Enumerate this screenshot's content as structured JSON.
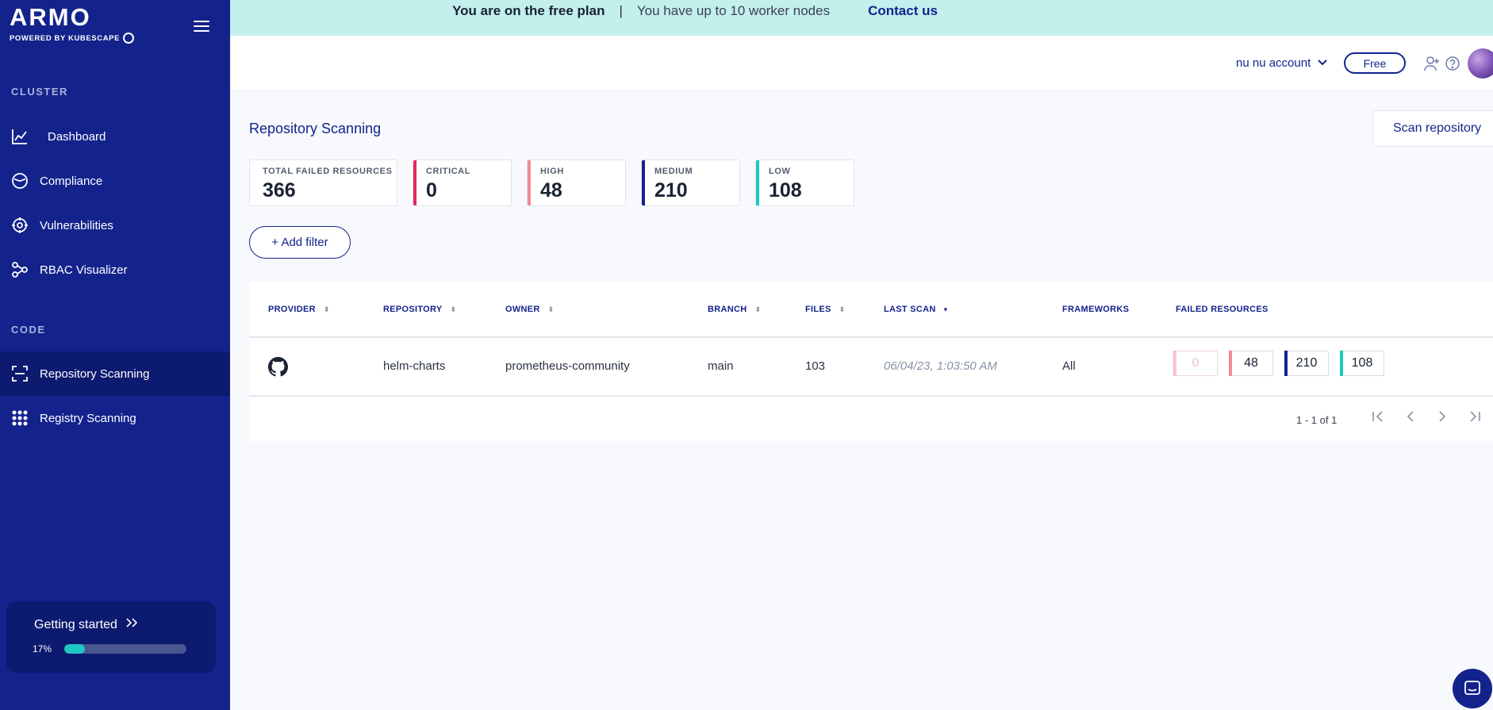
{
  "brand": {
    "name": "ARMO",
    "tagline": "POWERED BY KUBESCAPE"
  },
  "sidebar": {
    "sections": [
      {
        "label": "CLUSTER"
      },
      {
        "label": "CODE"
      }
    ],
    "cluster_items": [
      {
        "label": "Dashboard",
        "icon": "chart-icon"
      },
      {
        "label": "Compliance",
        "icon": "compliance-icon"
      },
      {
        "label": "Vulnerabilities",
        "icon": "vulnerability-icon"
      },
      {
        "label": "RBAC Visualizer",
        "icon": "graph-icon"
      }
    ],
    "code_items": [
      {
        "label": "Repository Scanning",
        "icon": "scan-icon",
        "active": true
      },
      {
        "label": "Registry Scanning",
        "icon": "grid-icon"
      }
    ],
    "getting_started": {
      "label": "Getting started",
      "percent_label": "17%",
      "progress": 0.17
    }
  },
  "banner": {
    "plan": "You are on the free plan",
    "separator": "|",
    "nodes": "You have up to 10 worker nodes",
    "contact": "Contact us"
  },
  "header": {
    "account": "nu nu account",
    "plan_pill": "Free"
  },
  "main": {
    "title": "Repository Scanning",
    "scan_button": "Scan repository",
    "add_filter": "+ Add filter",
    "stats": [
      {
        "label": "TOTAL FAILED RESOURCES",
        "value": "366"
      },
      {
        "label": "CRITICAL",
        "value": "0",
        "color": "#e8245c"
      },
      {
        "label": "HIGH",
        "value": "48",
        "color": "#f28a96"
      },
      {
        "label": "MEDIUM",
        "value": "210",
        "color": "#14238c"
      },
      {
        "label": "LOW",
        "value": "108",
        "color": "#1fc7c0"
      }
    ],
    "table": {
      "headers": [
        "PROVIDER",
        "REPOSITORY",
        "OWNER",
        "BRANCH",
        "FILES",
        "LAST SCAN",
        "FRAMEWORKS",
        "FAILED RESOURCES"
      ],
      "rows": [
        {
          "provider_icon": "github-icon",
          "repository": "helm-charts",
          "owner": "prometheus-community",
          "branch": "main",
          "files": "103",
          "last_scan": "06/04/23, 1:03:50 AM",
          "frameworks": "All",
          "failed": [
            "0",
            "48",
            "210",
            "108"
          ]
        }
      ],
      "pagination": "1 - 1 of 1"
    }
  }
}
